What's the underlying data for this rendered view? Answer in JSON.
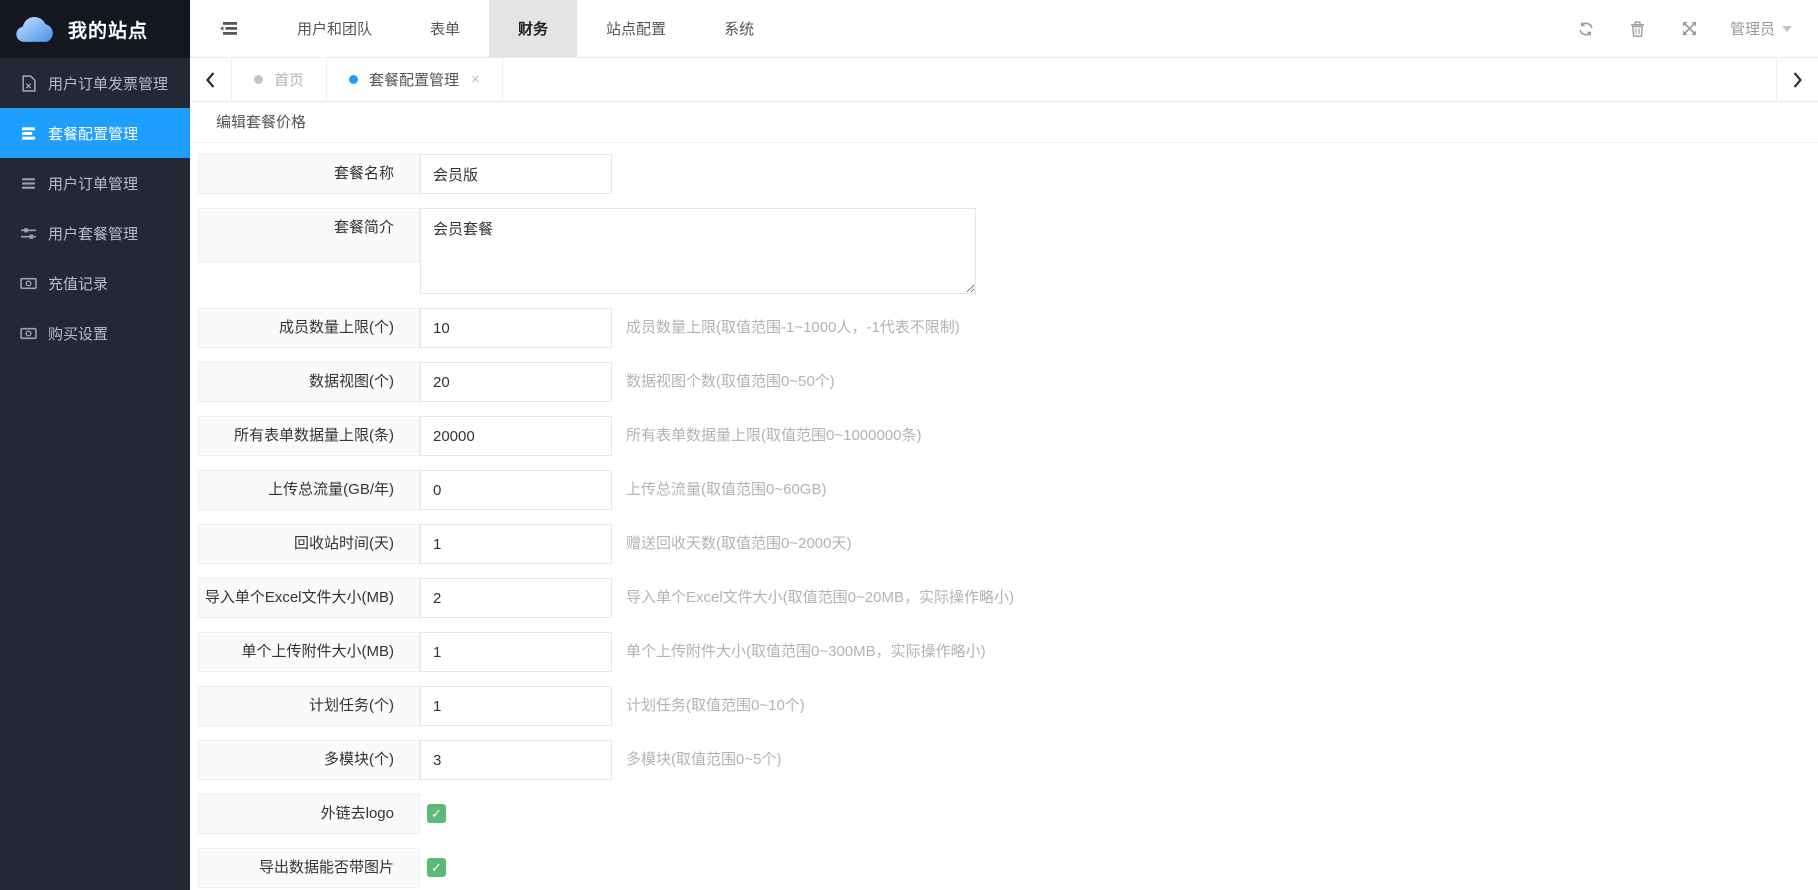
{
  "app": {
    "logo_text": "我的站点"
  },
  "header": {
    "nav": [
      {
        "label": "用户和团队"
      },
      {
        "label": "表单"
      },
      {
        "label": "财务"
      },
      {
        "label": "站点配置"
      },
      {
        "label": "系统"
      }
    ],
    "active_nav": "财务",
    "user": {
      "label": "管理员"
    },
    "icons": [
      "menu-fold",
      "refresh",
      "trash",
      "fullscreen",
      "caret-down"
    ]
  },
  "tabs": {
    "items": [
      {
        "label": "首页",
        "active": false
      },
      {
        "label": "套餐配置管理",
        "active": true,
        "close_glyph": "×"
      }
    ]
  },
  "sidebar": {
    "items": [
      {
        "label": "用户订单发票管理",
        "icon": "invoice-file-icon",
        "active": false
      },
      {
        "label": "套餐配置管理",
        "icon": "package-list-icon",
        "active": true
      },
      {
        "label": "用户订单管理",
        "icon": "order-list-icon",
        "active": false
      },
      {
        "label": "用户套餐管理",
        "icon": "sliders-icon",
        "active": false
      },
      {
        "label": "充值记录",
        "icon": "banknote-icon",
        "active": false
      },
      {
        "label": "购买设置",
        "icon": "banknote-icon",
        "active": false
      }
    ]
  },
  "panel": {
    "title": "编辑套餐价格"
  },
  "form": {
    "check_glyph": "✓",
    "rows": [
      {
        "label": "套餐名称",
        "value": "会员版",
        "hint": "",
        "type": "text"
      },
      {
        "label": "套餐简介",
        "value": "会员套餐",
        "hint": "",
        "type": "textarea"
      },
      {
        "label": "成员数量上限(个)",
        "value": "10",
        "hint": "成员数量上限(取值范围-1~1000人，-1代表不限制)",
        "type": "text"
      },
      {
        "label": "数据视图(个)",
        "value": "20",
        "hint": "数据视图个数(取值范围0~50个)",
        "type": "text"
      },
      {
        "label": "所有表单数据量上限(条)",
        "value": "20000",
        "hint": "所有表单数据量上限(取值范围0~1000000条)",
        "type": "text"
      },
      {
        "label": "上传总流量(GB/年)",
        "value": "0",
        "hint": "上传总流量(取值范围0~60GB)",
        "type": "text"
      },
      {
        "label": "回收站时间(天)",
        "value": "1",
        "hint": "赠送回收天数(取值范围0~2000天)",
        "type": "text"
      },
      {
        "label": "导入单个Excel文件大小(MB)",
        "value": "2",
        "hint": "导入单个Excel文件大小(取值范围0~20MB，实际操作略小)",
        "type": "text"
      },
      {
        "label": "单个上传附件大小(MB)",
        "value": "1",
        "hint": "单个上传附件大小(取值范围0~300MB，实际操作略小)",
        "type": "text"
      },
      {
        "label": "计划任务(个)",
        "value": "1",
        "hint": "计划任务(取值范围0~10个)",
        "type": "text"
      },
      {
        "label": "多模块(个)",
        "value": "3",
        "hint": "多模块(取值范围0~5个)",
        "type": "text"
      },
      {
        "label": "外链去logo",
        "checked": true,
        "type": "checkbox"
      },
      {
        "label": "导出数据能否带图片",
        "checked": true,
        "type": "checkbox"
      }
    ]
  },
  "colors": {
    "accent": "#1e9fff",
    "success": "#5fb878",
    "sidebar_bg": "#232834",
    "logo_bg": "#14171f"
  }
}
